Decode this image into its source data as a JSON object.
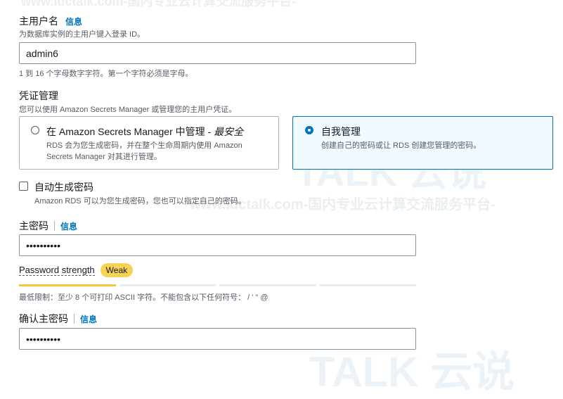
{
  "master_username": {
    "label": "主用户名",
    "info": "信息",
    "description": "为数据库实例的主用户键入登录 ID。",
    "value": "admin6",
    "constraint": "1 到 16 个字母数字字符。第一个字符必须是字母。"
  },
  "credentials": {
    "label": "凭证管理",
    "description": "您可以使用 Amazon Secrets Manager 或管理您的主用户凭证。",
    "option_secrets": {
      "title_main": "在 Amazon Secrets Manager 中管理 - ",
      "title_emphasis": "最安全",
      "desc_line1": "RDS 会为您生成密码，并在整个生命周期内使用 Amazon",
      "desc_line2": "Secrets Manager 对其进行管理。",
      "selected": false
    },
    "option_self": {
      "title": "自我管理",
      "desc": "创建自己的密码或让 RDS 创建您管理的密码。",
      "selected": true
    }
  },
  "auto_generate": {
    "label": "自动生成密码",
    "description": "Amazon RDS 可以为您生成密码，您也可以指定自己的密码。",
    "checked": false
  },
  "master_password": {
    "label": "主密码",
    "info": "信息",
    "value": "••••••••••",
    "strength_label": "Password strength",
    "strength_value": "Weak",
    "strength_level": 0.25,
    "constraint": "最低限制：至少 8 个可打印 ASCII 字符。不能包含以下任何符号： / ' \" @"
  },
  "confirm_password": {
    "label": "确认主密码",
    "info": "信息",
    "value": "••••••••••"
  },
  "watermark": {
    "site": "www.idctalk.com-国内专业云计算交流服务平台-",
    "brand": "TALK 云说"
  },
  "colors": {
    "accent": "#0073bb",
    "strength": "#f2c53d",
    "badge": "#f7d355"
  }
}
